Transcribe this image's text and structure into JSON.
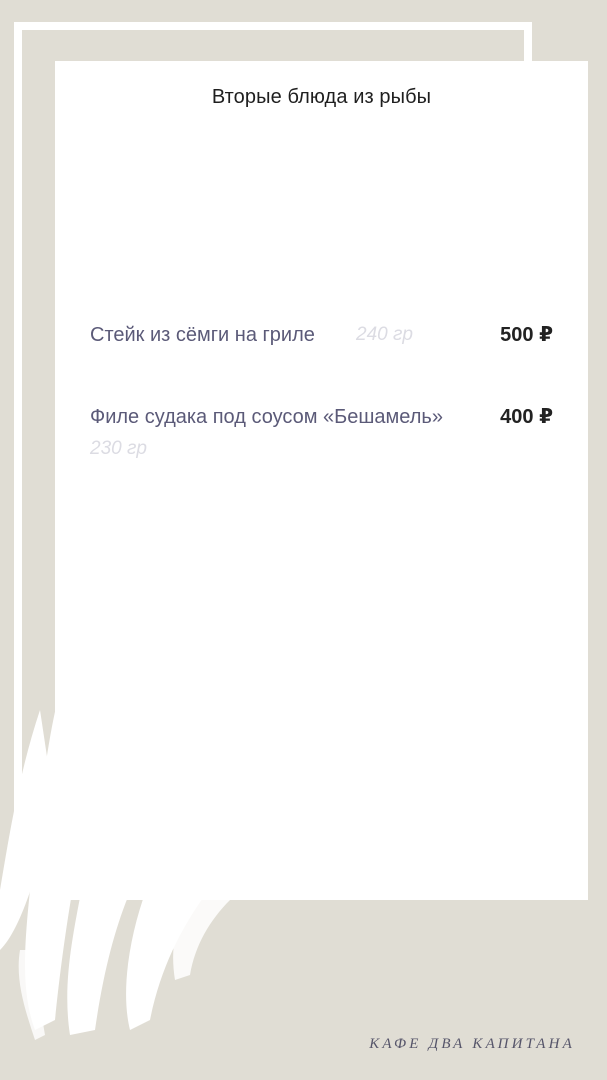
{
  "theme": {
    "background": "#e0ddd4",
    "card": "#ffffff",
    "item_name_color": "#5b5a78",
    "weight_color": "#dcdce3",
    "price_color": "#222222"
  },
  "menu": {
    "title": "Вторые блюда из рыбы",
    "items": [
      {
        "name": "Стейк из сёмги на гриле",
        "weight": "240 гр",
        "price": "500 ₽"
      },
      {
        "name": "Филе судака под соусом «Бешамель»",
        "weight": "230 гр",
        "price": "400 ₽"
      }
    ]
  },
  "footer": {
    "brand": "КАФЕ ДВА КАПИТАНА"
  },
  "decorations": {
    "icons": [
      "brush-stroke-decoration"
    ]
  }
}
